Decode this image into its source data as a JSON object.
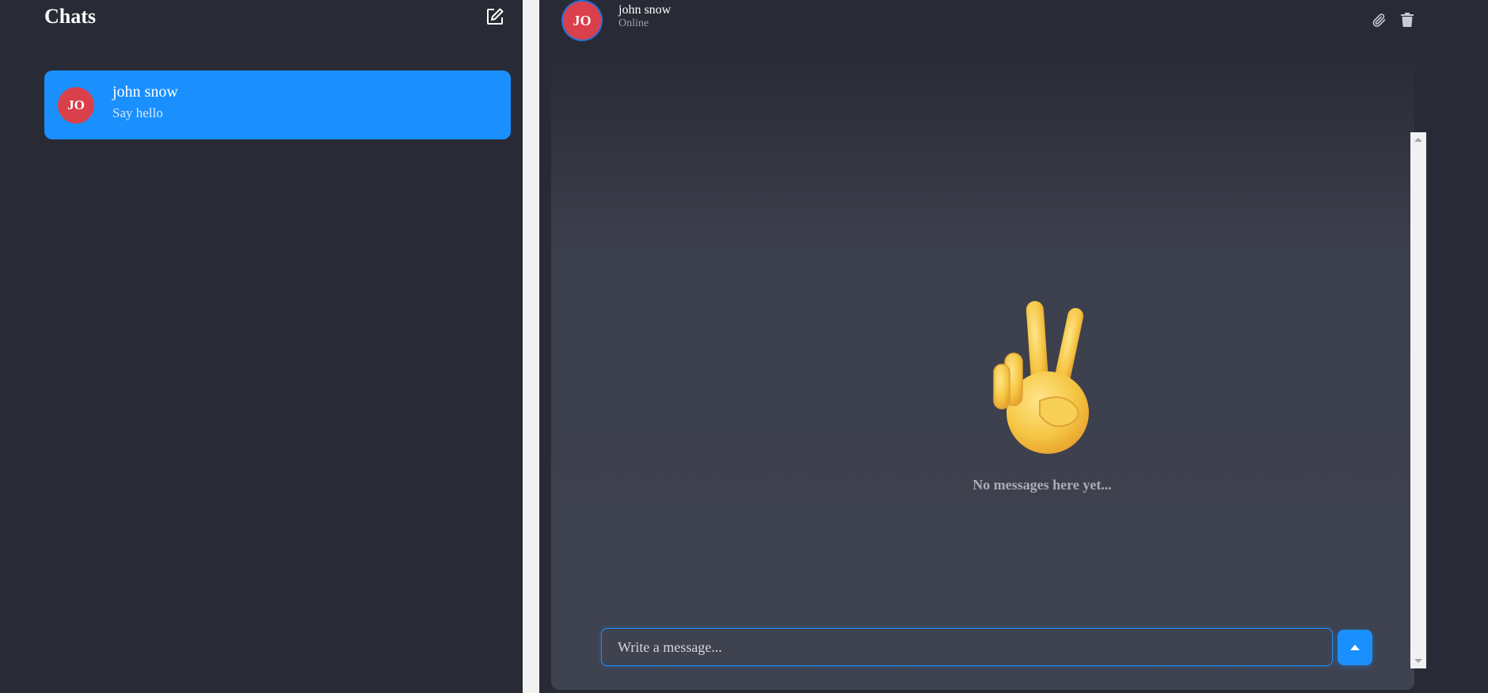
{
  "sidebar": {
    "title": "Chats",
    "compose_icon": "compose-icon",
    "chats": [
      {
        "initials": "JO",
        "name": "john snow",
        "preview": "Say hello",
        "active": true
      }
    ]
  },
  "header": {
    "initials": "JO",
    "name": "john snow",
    "status": "Online",
    "attach_icon": "paperclip-icon",
    "delete_icon": "trash-icon"
  },
  "empty_state": {
    "icon": "peace-hand-icon",
    "message": "No messages here yet..."
  },
  "composer": {
    "placeholder": "Write a message...",
    "value": "",
    "send_icon": "send-arrow-icon"
  },
  "colors": {
    "background": "#282b36",
    "accent": "#1a90ff",
    "avatar": "#d9404b",
    "panel": "#3f424f"
  }
}
